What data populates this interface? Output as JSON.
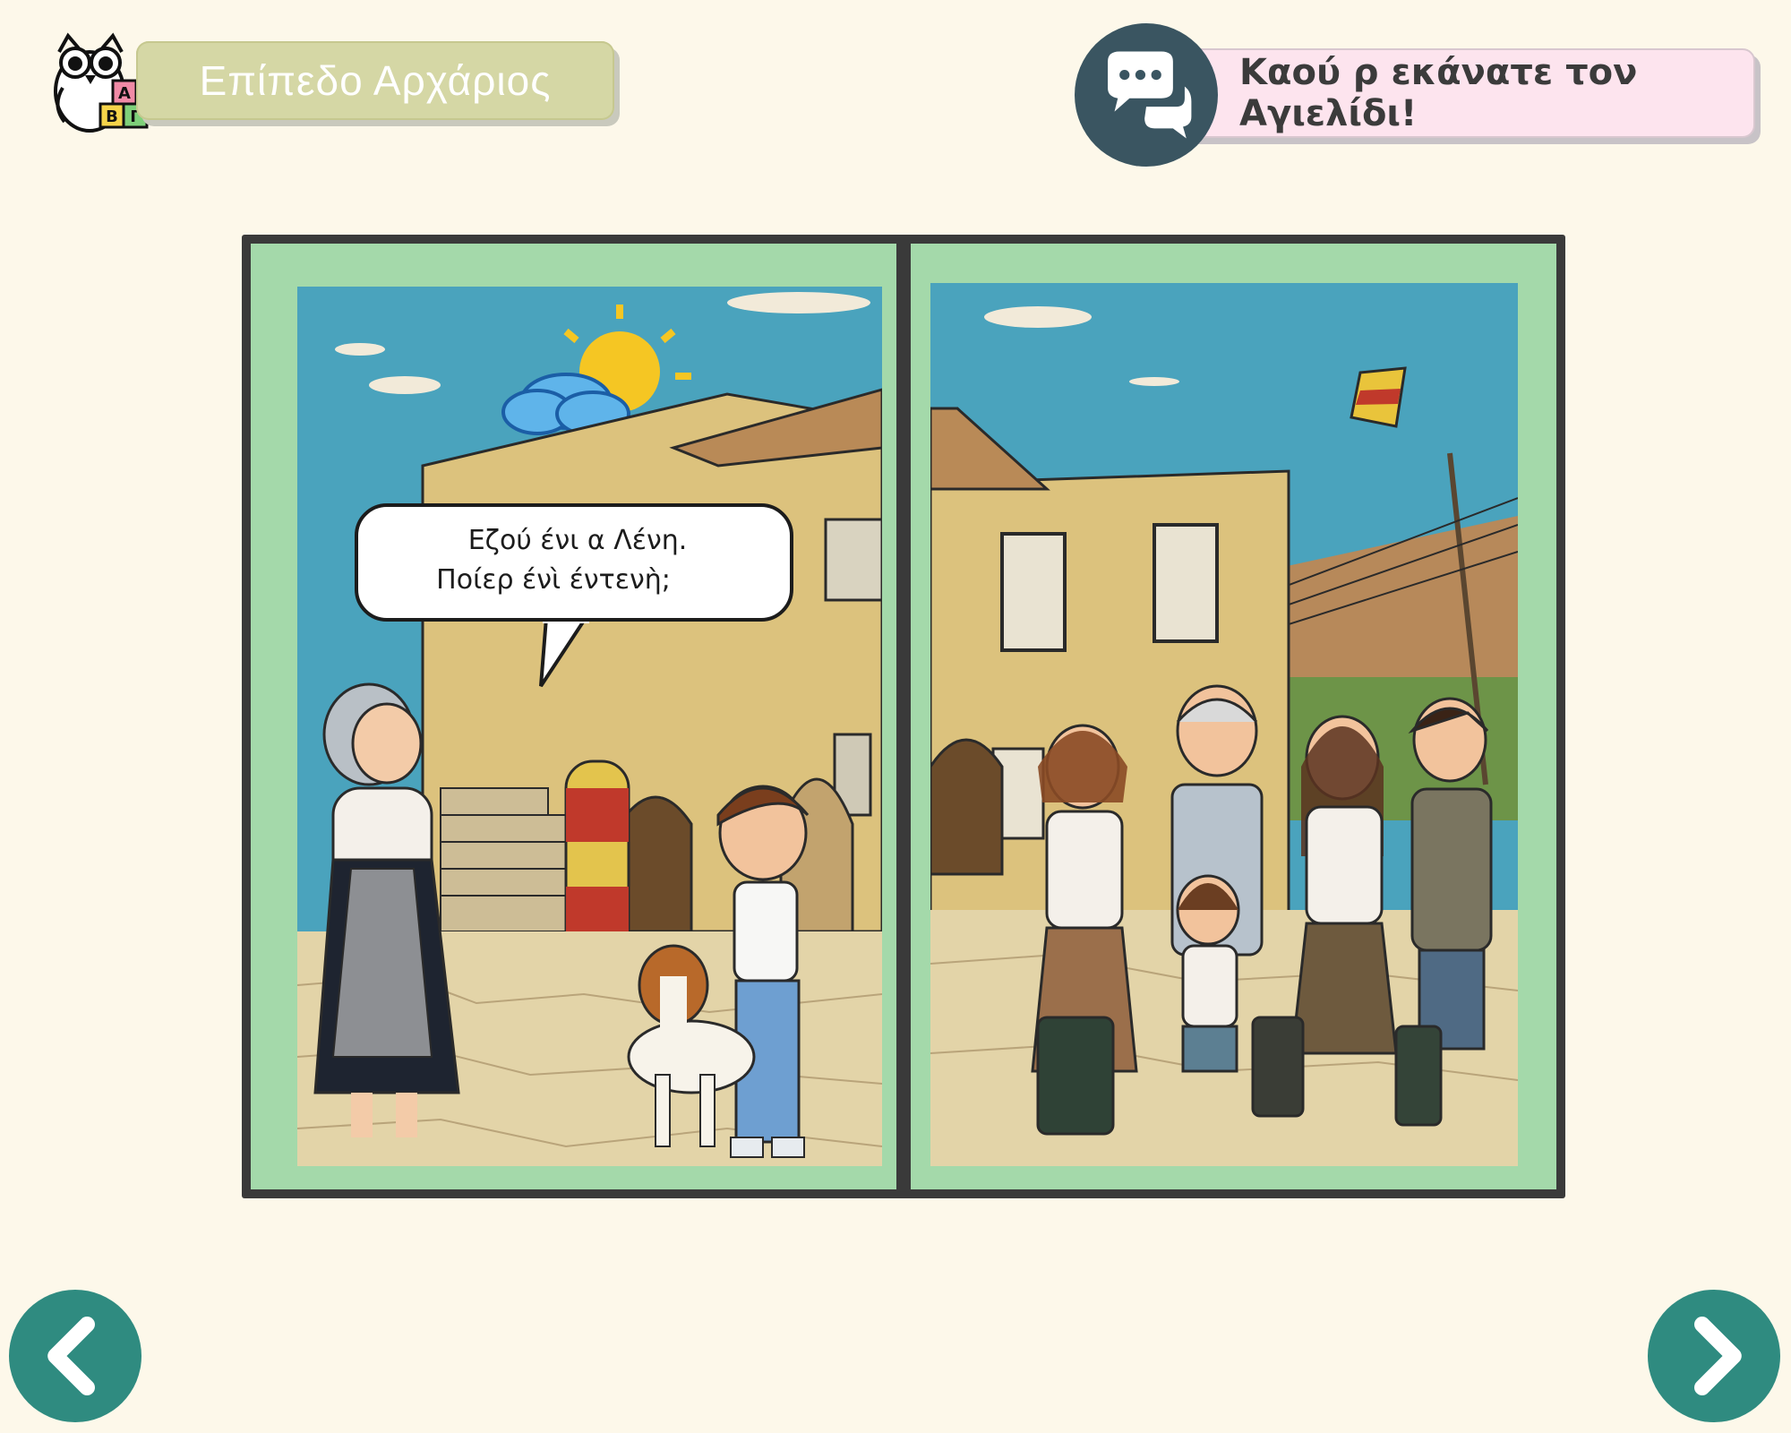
{
  "header": {
    "level_label": "Επίπεδο Αρχάριος",
    "owl_blocks": [
      "Α",
      "Β",
      "Γ"
    ],
    "lesson_title": "Καού ρ εκάνατε τον Αγιελίδι!",
    "icons": {
      "owl": "owl-logo-icon",
      "chat": "speech-bubbles-icon"
    }
  },
  "story": {
    "speech_line_1": "Εζού ένι α Λένη.",
    "speech_line_2": "Ποίερ ένὶ έντενὴ;"
  },
  "navigation": {
    "prev_icon": "chevron-left-icon",
    "next_icon": "chevron-right-icon"
  },
  "colors": {
    "background": "#fdf8ea",
    "level_pill": "#d5d7a5",
    "title_pill": "#fde4ee",
    "page_border": "#a4d9aa",
    "book_frame": "#3a3a3a",
    "nav_button": "#2f8b80",
    "chat_circle": "#3a5561"
  }
}
